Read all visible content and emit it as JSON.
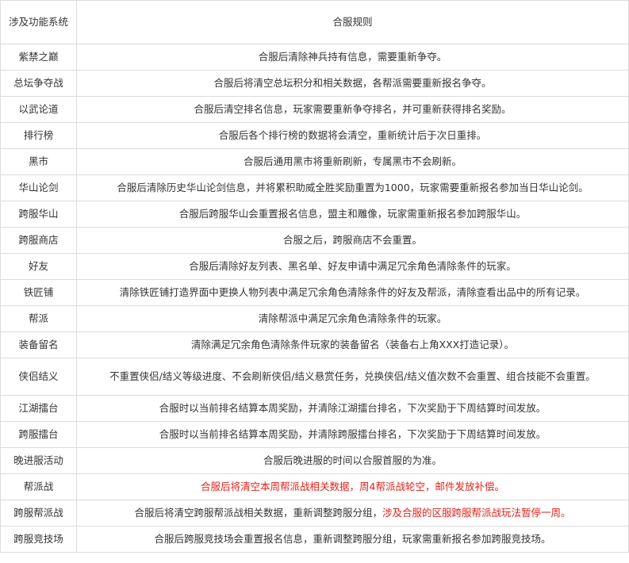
{
  "table": {
    "headers": [
      "涉及功能系统",
      "合服规则"
    ],
    "rows": [
      {
        "system": "紫禁之巅",
        "rule": "合服后清除神兵持有信息，需要重新争夺。"
      },
      {
        "system": "总坛争夺战",
        "rule": "合服后将清空总坛积分和相关数据，各帮派需要重新报名争夺。"
      },
      {
        "system": "以武论道",
        "rule": "合服后清空排名信息，玩家需要重新争夺排名，并可重新获得排名奖励。"
      },
      {
        "system": "排行榜",
        "rule": "合服后各个排行榜的数据将会清空，重新统计后于次日重排。"
      },
      {
        "system": "黑市",
        "rule": "合服后通用黑市将重新刷新，专属黑市不会刷新。"
      },
      {
        "system": "华山论剑",
        "rule": "合服后清除历史华山论剑信息，并将累积助威全胜奖励重置为1000，玩家需要重新报名参加当日华山论剑。"
      },
      {
        "system": "跨服华山",
        "rule": "合服后跨服华山会重置报名信息，盟主和雕像，玩家需重新报名参加跨服华山。"
      },
      {
        "system": "跨服商店",
        "rule": "合服之后，跨服商店不会重置。"
      },
      {
        "system": "好友",
        "rule": "合服后清除好友列表、黑名单、好友申请中满足冗余角色清除条件的玩家。"
      },
      {
        "system": "铁匠铺",
        "rule": "清除铁匠铺打造界面中更换人物列表中满足冗余角色清除条件的好友及帮派，清除查看出品中的所有记录。"
      },
      {
        "system": "帮派",
        "rule": "清除帮派中满足冗余角色清除条件的玩家。"
      },
      {
        "system": "装备留名",
        "rule": "清除满足冗余角色清除条件玩家的装备留名（装备右上角XXX打造记录）。"
      },
      {
        "system": "侠侣结义",
        "rule": "不重置侠侣/结义等级进度、不会刷新侠侣/结义悬赏任务，兑换侠侣/结义值次数不会重置、组合技能不会重置。"
      },
      {
        "system": "江湖擂台",
        "rule": "合服时以当前排名结算本周奖励，并清除江湖擂台排名，下次奖励于下周结算时间发放。"
      },
      {
        "system": "跨服擂台",
        "rule": "合服时以当前排名结算本周奖励，并清除跨服擂台排名，下次奖励于下周结算时间发放。"
      },
      {
        "system": "晚进服活动",
        "rule": "合服后晚进服的时间以合服首服的为准。"
      },
      {
        "system": "帮派战",
        "rule": "合服后将清空本周帮派战相关数据，周4帮派战轮空，邮件发放补偿。"
      },
      {
        "system": "跨服帮派战",
        "rule": "合服后将清空跨服帮派战相关数据，重新调整跨服分组，",
        "rule_highlight": "涉及合服的区服跨服帮派战玩法暂停一周。"
      },
      {
        "system": "跨服竞技场",
        "rule": "合服后跨服竞技场会重置报名信息，重新调整跨服分组，玩家需重新报名参加跨服竞技场。"
      }
    ]
  },
  "colors": {
    "text": "#333333",
    "highlight": "#e2231a",
    "border": "#dddddd"
  }
}
